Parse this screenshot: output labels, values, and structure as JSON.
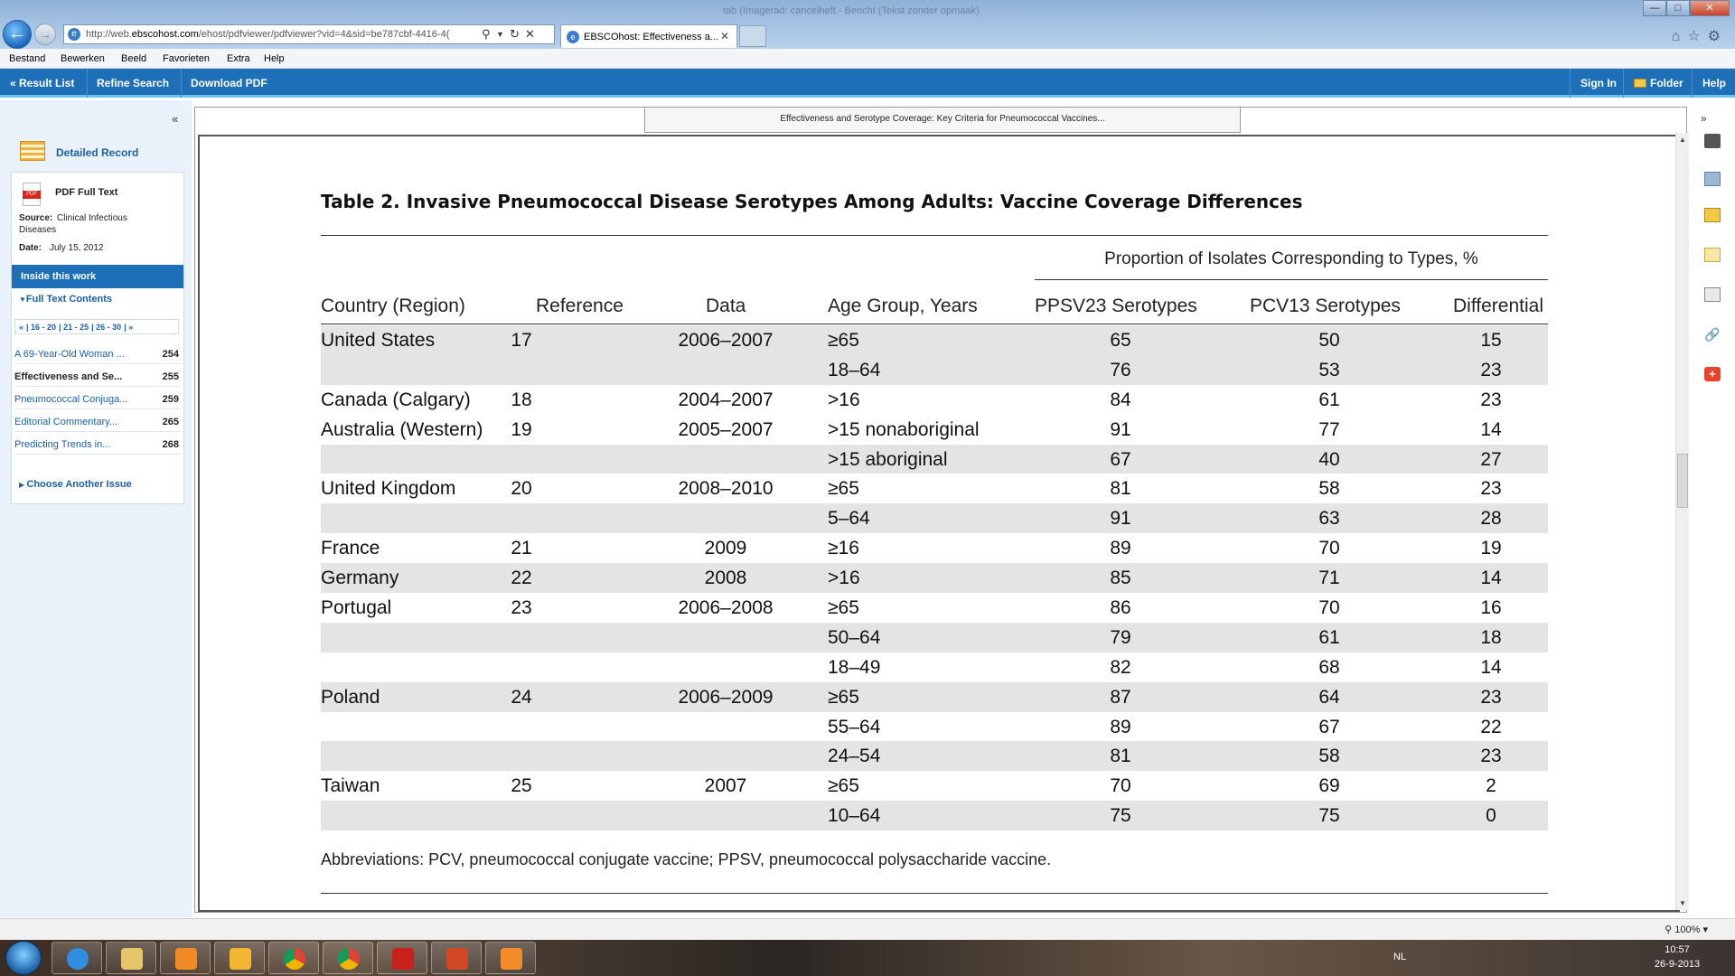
{
  "browser": {
    "window_title": "tab (Imagerad: cancelheft - Bericht (Tekst zonder opmaak)",
    "url_host": "http://web.",
    "url_domain": "ebscohost.com",
    "url_path": "/ehost/pdfviewer/pdfviewer?vid=4&sid=be787cbf-4416-4(",
    "tab_label": "EBSCOhost: Effectiveness a...",
    "menu": [
      "Bestand",
      "Bewerken",
      "Beeld",
      "Favorieten",
      "Extra",
      "Help"
    ]
  },
  "toolbar": {
    "result_list": "« Result List",
    "refine_search": "Refine Search",
    "download_pdf": "Download PDF",
    "sign_in": "Sign In",
    "folder": "Folder",
    "help": "Help"
  },
  "left": {
    "collapse": "«",
    "detailed_record": "Detailed Record",
    "pdf_full_text": "PDF Full Text",
    "source_label": "Source:",
    "source_value": "Clinical Infectious",
    "source_value2": "Diseases",
    "date_label": "Date:",
    "date_value": "July 15, 2012",
    "inside_this_work": "Inside this work",
    "full_text_contents": "Full Text Contents",
    "pager": [
      "«",
      "16 - 20",
      "21 - 25",
      "26 - 30",
      "»"
    ],
    "toc": [
      {
        "title": "A 69-Year-Old Woman ...",
        "page": "254"
      },
      {
        "title": "Effectiveness and Se...",
        "page": "255"
      },
      {
        "title": "Pneumococcal Conjuga...",
        "page": "259"
      },
      {
        "title": "Editorial Commentary...",
        "page": "265"
      },
      {
        "title": "Predicting Trends in...",
        "page": "268"
      }
    ],
    "choose_another": "Choose Another Issue"
  },
  "viewer": {
    "doc_title": "Effectiveness and Serotype Coverage: Key Criteria for Pneumococcal Vaccines...",
    "table_title": "Table 2.    Invasive Pneumococcal Disease Serotypes Among Adults: Vaccine Coverage Differences",
    "span_header": "Proportion of Isolates Corresponding to Types, %",
    "columns": [
      "Country (Region)",
      "Reference",
      "Data",
      "Age Group, Years",
      "PPSV23 Serotypes",
      "PCV13 Serotypes",
      "Differential"
    ],
    "rows": [
      [
        "United States",
        "17",
        "2006–2007",
        "≥65",
        "65",
        "50",
        "15"
      ],
      [
        "",
        "",
        "",
        "18–64",
        "76",
        "53",
        "23"
      ],
      [
        "Canada (Calgary)",
        "18",
        "2004–2007",
        ">16",
        "84",
        "61",
        "23"
      ],
      [
        "Australia (Western)",
        "19",
        "2005–2007",
        ">15 nonaboriginal",
        "91",
        "77",
        "14"
      ],
      [
        "",
        "",
        "",
        ">15 aboriginal",
        "67",
        "40",
        "27"
      ],
      [
        "United Kingdom",
        "20",
        "2008–2010",
        "≥65",
        "81",
        "58",
        "23"
      ],
      [
        "",
        "",
        "",
        "5–64",
        "91",
        "63",
        "28"
      ],
      [
        "France",
        "21",
        "2009",
        "≥16",
        "89",
        "70",
        "19"
      ],
      [
        "Germany",
        "22",
        "2008",
        ">16",
        "85",
        "71",
        "14"
      ],
      [
        "Portugal",
        "23",
        "2006–2008",
        "≥65",
        "86",
        "70",
        "16"
      ],
      [
        "",
        "",
        "",
        "50–64",
        "79",
        "61",
        "18"
      ],
      [
        "",
        "",
        "",
        "18–49",
        "82",
        "68",
        "14"
      ],
      [
        "Poland",
        "24",
        "2006–2009",
        "≥65",
        "87",
        "64",
        "23"
      ],
      [
        "",
        "",
        "",
        "55–64",
        "89",
        "67",
        "22"
      ],
      [
        "",
        "",
        "",
        "24–54",
        "81",
        "58",
        "23"
      ],
      [
        "Taiwan",
        "25",
        "2007",
        "≥65",
        "70",
        "69",
        "2"
      ],
      [
        "",
        "",
        "",
        "10–64",
        "75",
        "75",
        "0"
      ]
    ],
    "shaded_rows": [
      0,
      1,
      4,
      6,
      8,
      10,
      12,
      14,
      16
    ],
    "abbreviations": "Abbreviations: PCV, pneumococcal conjugate vaccine; PPSV, pneumococcal polysaccharide vaccine.",
    "collapse_right": "»"
  },
  "status": {
    "zoom": "100%"
  },
  "taskbar": {
    "language": "NL",
    "time": "10:57",
    "date": "26-9-2013"
  },
  "colors": {
    "accent": "#1d6fb8",
    "accent_light": "#6cc2e8",
    "link": "#1d5fa8",
    "row_shade": "#e4e4e4"
  }
}
